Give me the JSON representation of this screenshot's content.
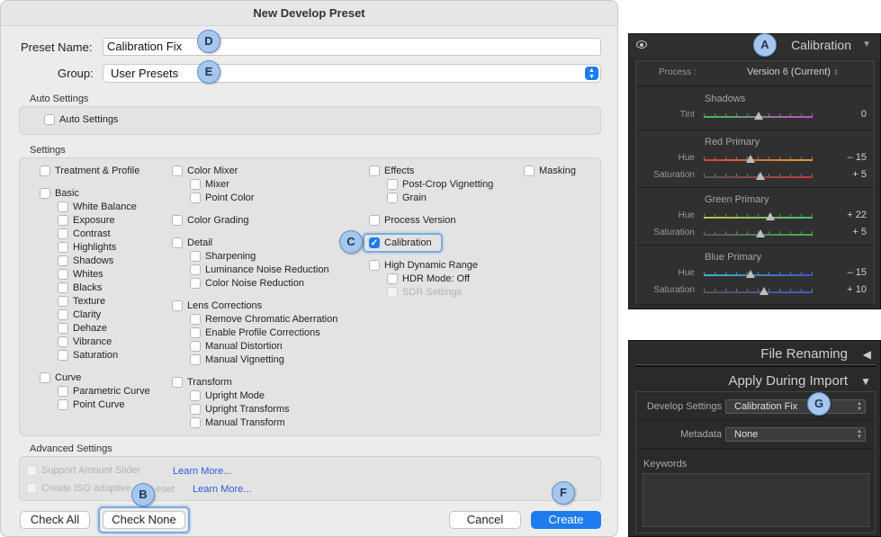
{
  "dialog": {
    "title": "New Develop Preset",
    "preset_name_label": "Preset Name:",
    "preset_name_value": "Calibration Fix",
    "group_label": "Group:",
    "group_value": "User Presets",
    "auto_settings": {
      "header": "Auto Settings",
      "checkbox": "Auto Settings"
    },
    "settings_header": "Settings",
    "settings": {
      "col1": {
        "treatment_profile": "Treatment & Profile",
        "basic": "Basic",
        "basic_items": [
          "White Balance",
          "Exposure",
          "Contrast",
          "Highlights",
          "Shadows",
          "Whites",
          "Blacks",
          "Texture",
          "Clarity",
          "Dehaze",
          "Vibrance",
          "Saturation"
        ],
        "curve": "Curve",
        "curve_items": [
          "Parametric Curve",
          "Point Curve"
        ]
      },
      "col2": {
        "color_mixer": "Color Mixer",
        "color_mixer_items": [
          "Mixer",
          "Point Color"
        ],
        "color_grading": "Color Grading",
        "detail": "Detail",
        "detail_items": [
          "Sharpening",
          "Luminance Noise Reduction",
          "Color Noise Reduction"
        ],
        "lens_corrections": "Lens Corrections",
        "lens_items": [
          "Remove Chromatic Aberration",
          "Enable Profile Corrections",
          "Manual Distortion",
          "Manual Vignetting"
        ],
        "transform": "Transform",
        "transform_items": [
          "Upright Mode",
          "Upright Transforms",
          "Manual Transform"
        ]
      },
      "col3": {
        "effects": "Effects",
        "effects_items": [
          "Post-Crop Vignetting",
          "Grain"
        ],
        "process_version": "Process Version",
        "calibration": "Calibration",
        "hdr": "High Dynamic Range",
        "hdr_items": [
          "HDR Mode: Off",
          "SDR Settings"
        ]
      },
      "col4": {
        "masking": "Masking"
      }
    },
    "advanced": {
      "header": "Advanced Settings",
      "support_amount": "Support Amount Slider",
      "iso_adaptive_a": "Create ISO adaptive",
      "iso_adaptive_b": "eset",
      "learn_more_1": "Learn More...",
      "learn_more_2": "Learn More..."
    },
    "buttons": {
      "check_all": "Check All",
      "check_none": "Check None",
      "cancel": "Cancel",
      "create": "Create"
    }
  },
  "badges": {
    "a": "A",
    "b": "B",
    "c": "C",
    "d": "D",
    "e": "E",
    "f": "F",
    "g": "G"
  },
  "calibration_panel": {
    "title": "Calibration",
    "process_label": "Process :",
    "process_value": "Version 6 (Current)",
    "groups": [
      {
        "title": "Shadows",
        "sliders": [
          {
            "label": "Tint",
            "value": "0",
            "position": 0.5,
            "colors": [
              "#3dbf55",
              "#c84cc8"
            ]
          }
        ]
      },
      {
        "title": "Red Primary",
        "sliders": [
          {
            "label": "Hue",
            "value": "– 15",
            "position": 0.43,
            "colors": [
              "#d84040",
              "#e0a030"
            ]
          },
          {
            "label": "Saturation",
            "value": "+ 5",
            "position": 0.52,
            "colors": [
              "#555555",
              "#cc3a3a"
            ]
          }
        ]
      },
      {
        "title": "Green Primary",
        "sliders": [
          {
            "label": "Hue",
            "value": "+ 22",
            "position": 0.61,
            "colors": [
              "#c6c23a",
              "#3dc07a"
            ]
          },
          {
            "label": "Saturation",
            "value": "+ 5",
            "position": 0.52,
            "colors": [
              "#555555",
              "#3dba50"
            ]
          }
        ]
      },
      {
        "title": "Blue Primary",
        "sliders": [
          {
            "label": "Hue",
            "value": "– 15",
            "position": 0.43,
            "colors": [
              "#38b8c8",
              "#3a56d0"
            ]
          },
          {
            "label": "Saturation",
            "value": "+ 10",
            "position": 0.55,
            "colors": [
              "#555555",
              "#3b5ed6"
            ]
          }
        ]
      }
    ]
  },
  "import_panel": {
    "file_renaming": "File Renaming",
    "apply_during_import": "Apply During Import",
    "develop_settings_label": "Develop Settings",
    "develop_settings_value": "Calibration Fix",
    "metadata_label": "Metadata",
    "metadata_value": "None",
    "keywords_label": "Keywords"
  },
  "colors": {
    "accent": "#1f7cf0",
    "badge_fill": "#a7c6ec",
    "panel_bg": "#2a2a2a"
  }
}
